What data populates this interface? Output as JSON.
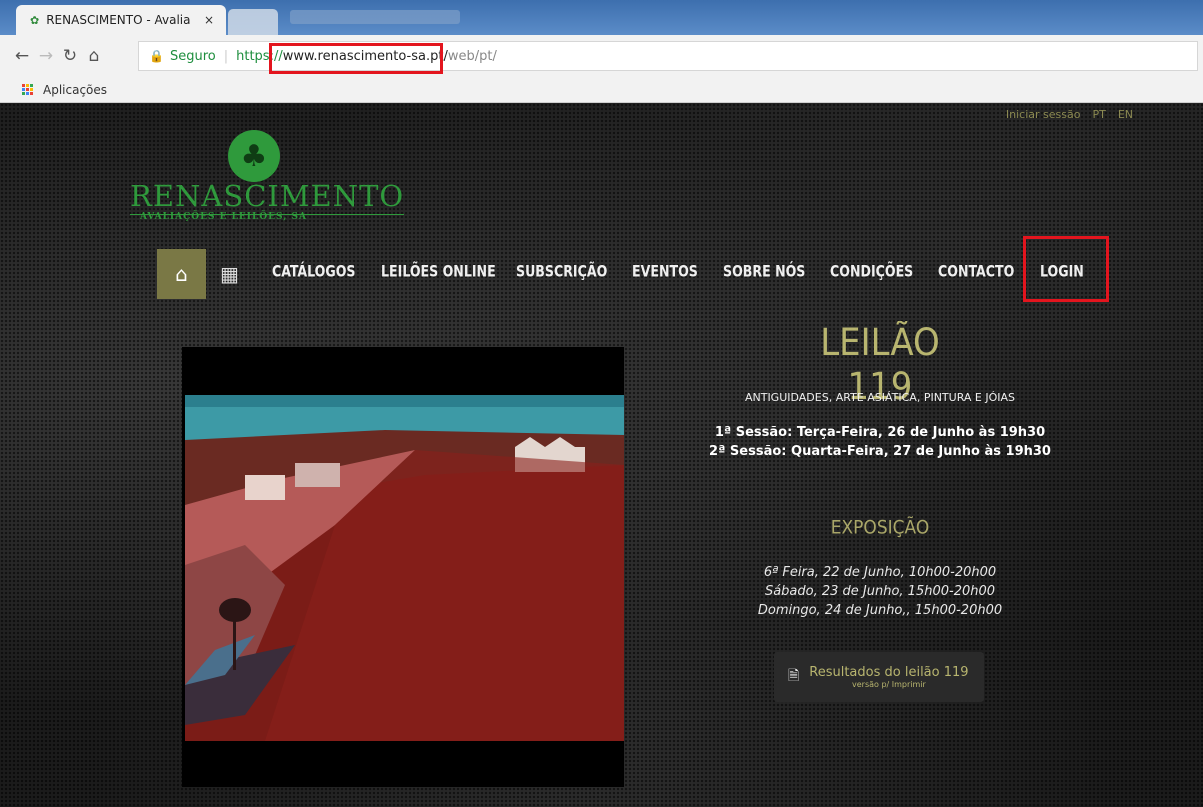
{
  "browser": {
    "tab_title": "RENASCIMENTO - Avalia",
    "tab_close": "×",
    "security_label": "Seguro",
    "url_scheme": "https://",
    "url_host": "www.renascimento-sa.pt/",
    "url_path": "web/pt/",
    "bookmarks_apps": "Aplicações"
  },
  "site": {
    "topbar": {
      "login_link": "Iniciar sessão",
      "lang_pt": "PT",
      "lang_en": "EN"
    },
    "logo": {
      "name": "RENASCIMENTO",
      "subtitle": "AVALIAÇÕES E LEILÕES, SA"
    },
    "nav": {
      "items": [
        "CATÁLOGOS",
        "LEILÕES ONLINE",
        "SUBSCRIÇÃO",
        "EVENTOS",
        "SOBRE NÓS",
        "CONDIÇÕES",
        "CONTACTO",
        "LOGIN"
      ]
    },
    "auction": {
      "title": "LEILÃO 119",
      "subtitle": "ANTIGUIDADES, ARTE ASIÁTICA, PINTURA E JÓIAS",
      "session_1": "1ª Sessão: Terça-Feira, 26 de Junho às 19h30",
      "session_2": "2ª Sessão: Quarta-Feira, 27 de Junho às 19h30",
      "exhibition_title": "EXPOSIÇÃO",
      "exhibition_dates": [
        "6ª Feira, 22 de Junho, 10h00-20h00",
        "Sábado, 23 de Junho, 15h00-20h00",
        "Domingo, 24 de Junho,, 15h00-20h00"
      ],
      "results_button": "Resultados do leilão 119",
      "results_button_sub": "versão p/ Imprimir"
    }
  },
  "icons": {
    "favicon": "tree-icon",
    "back": "arrow-left-icon",
    "forward": "arrow-right-icon",
    "reload": "reload-icon",
    "home_browser": "home-icon",
    "lock": "lock-icon",
    "apps": "apps-grid-icon",
    "nav_home": "home-icon",
    "calendar": "calendar-icon",
    "pdf": "pdf-icon"
  },
  "colors": {
    "accent_gold": "#b8b56f",
    "logo_green": "#2f9a3c",
    "highlight_red": "#e3151e",
    "nav_home_bg": "#7a7845"
  }
}
